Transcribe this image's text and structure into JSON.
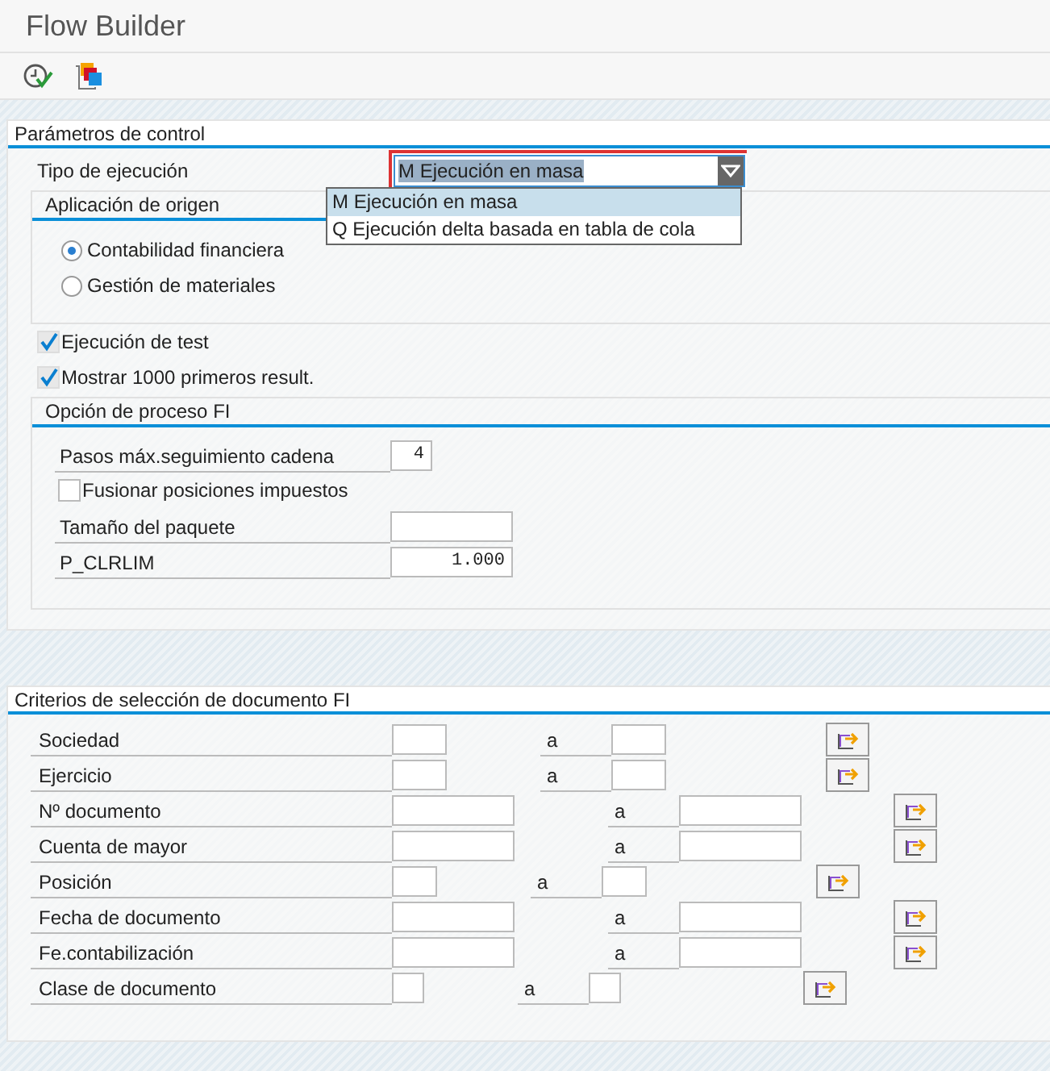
{
  "window": {
    "title": "Flow Builder"
  },
  "toolbar": [
    {
      "kind": "execute"
    },
    {
      "kind": "variants"
    }
  ],
  "control": {
    "title": "Parámetros de control",
    "run_type": {
      "label": "Tipo de ejecución",
      "value": "M Ejecución en masa",
      "expanded": true,
      "options": [
        {
          "label": "M Ejecución en masa",
          "selected": true
        },
        {
          "label": "Q Ejecución delta basada en tabla de cola",
          "selected": false
        }
      ]
    },
    "source": {
      "title": "Aplicación de origen",
      "options": [
        {
          "label": "Contabilidad financiera",
          "selected": true
        },
        {
          "label": "Gestión de materiales",
          "selected": false
        }
      ]
    },
    "checks": [
      {
        "label": "Ejecución de test",
        "checked": true
      },
      {
        "label": "Mostrar 1000 primeros result.",
        "checked": true
      }
    ],
    "fi": {
      "title": "Opción de proceso FI",
      "items": [
        {
          "kind": "field",
          "label": "Pasos máx.seguimiento cadena",
          "value": "4"
        },
        {
          "kind": "checkbox",
          "label": "Fusionar posiciones impuestos",
          "checked": false
        },
        {
          "kind": "field",
          "label": "Tamaño del paquete"
        },
        {
          "kind": "field",
          "label": "P_CLRLIM",
          "value": "1.000"
        }
      ]
    }
  },
  "selection": {
    "title": "Criterios de selección de documento FI",
    "rows": [
      {
        "label": "Sociedad",
        "to": "a"
      },
      {
        "label": "Ejercicio",
        "to": "a"
      },
      {
        "label": "Nº documento",
        "to": "a"
      },
      {
        "label": "Cuenta de mayor",
        "to": "a"
      },
      {
        "label": "Posición",
        "to": "a"
      },
      {
        "label": "Fecha de documento",
        "to": "a"
      },
      {
        "label": "Fe.contabilización",
        "to": "a"
      },
      {
        "label": "Clase de documento",
        "to": "a"
      }
    ]
  }
}
